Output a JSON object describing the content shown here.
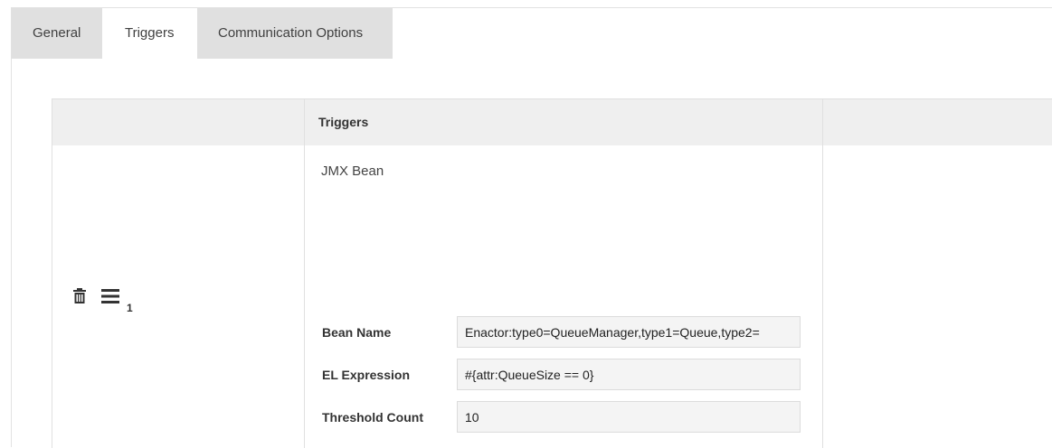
{
  "tabs": [
    {
      "label": "General",
      "active": false
    },
    {
      "label": "Triggers",
      "active": true
    },
    {
      "label": "Communication Options",
      "active": false
    }
  ],
  "table": {
    "header": {
      "col1": "",
      "col2": "Triggers",
      "col3": ""
    },
    "rows": [
      {
        "index": "1",
        "type": "JMX Bean",
        "fields": [
          {
            "label": "Bean Name",
            "value": "Enactor:type0=QueueManager,type1=Queue,type2="
          },
          {
            "label": "EL Expression",
            "value": "#{attr:QueueSize == 0}"
          },
          {
            "label": "Threshold Count",
            "value": "10"
          }
        ]
      }
    ]
  },
  "icons": {
    "delete": "trash-icon",
    "reorder": "hamburger-menu-icon"
  },
  "colors": {
    "tab_inactive_bg": "#e0e0e0",
    "header_bg": "#efefef",
    "input_bg": "#f4f4f4",
    "border": "#e0e0e0"
  }
}
